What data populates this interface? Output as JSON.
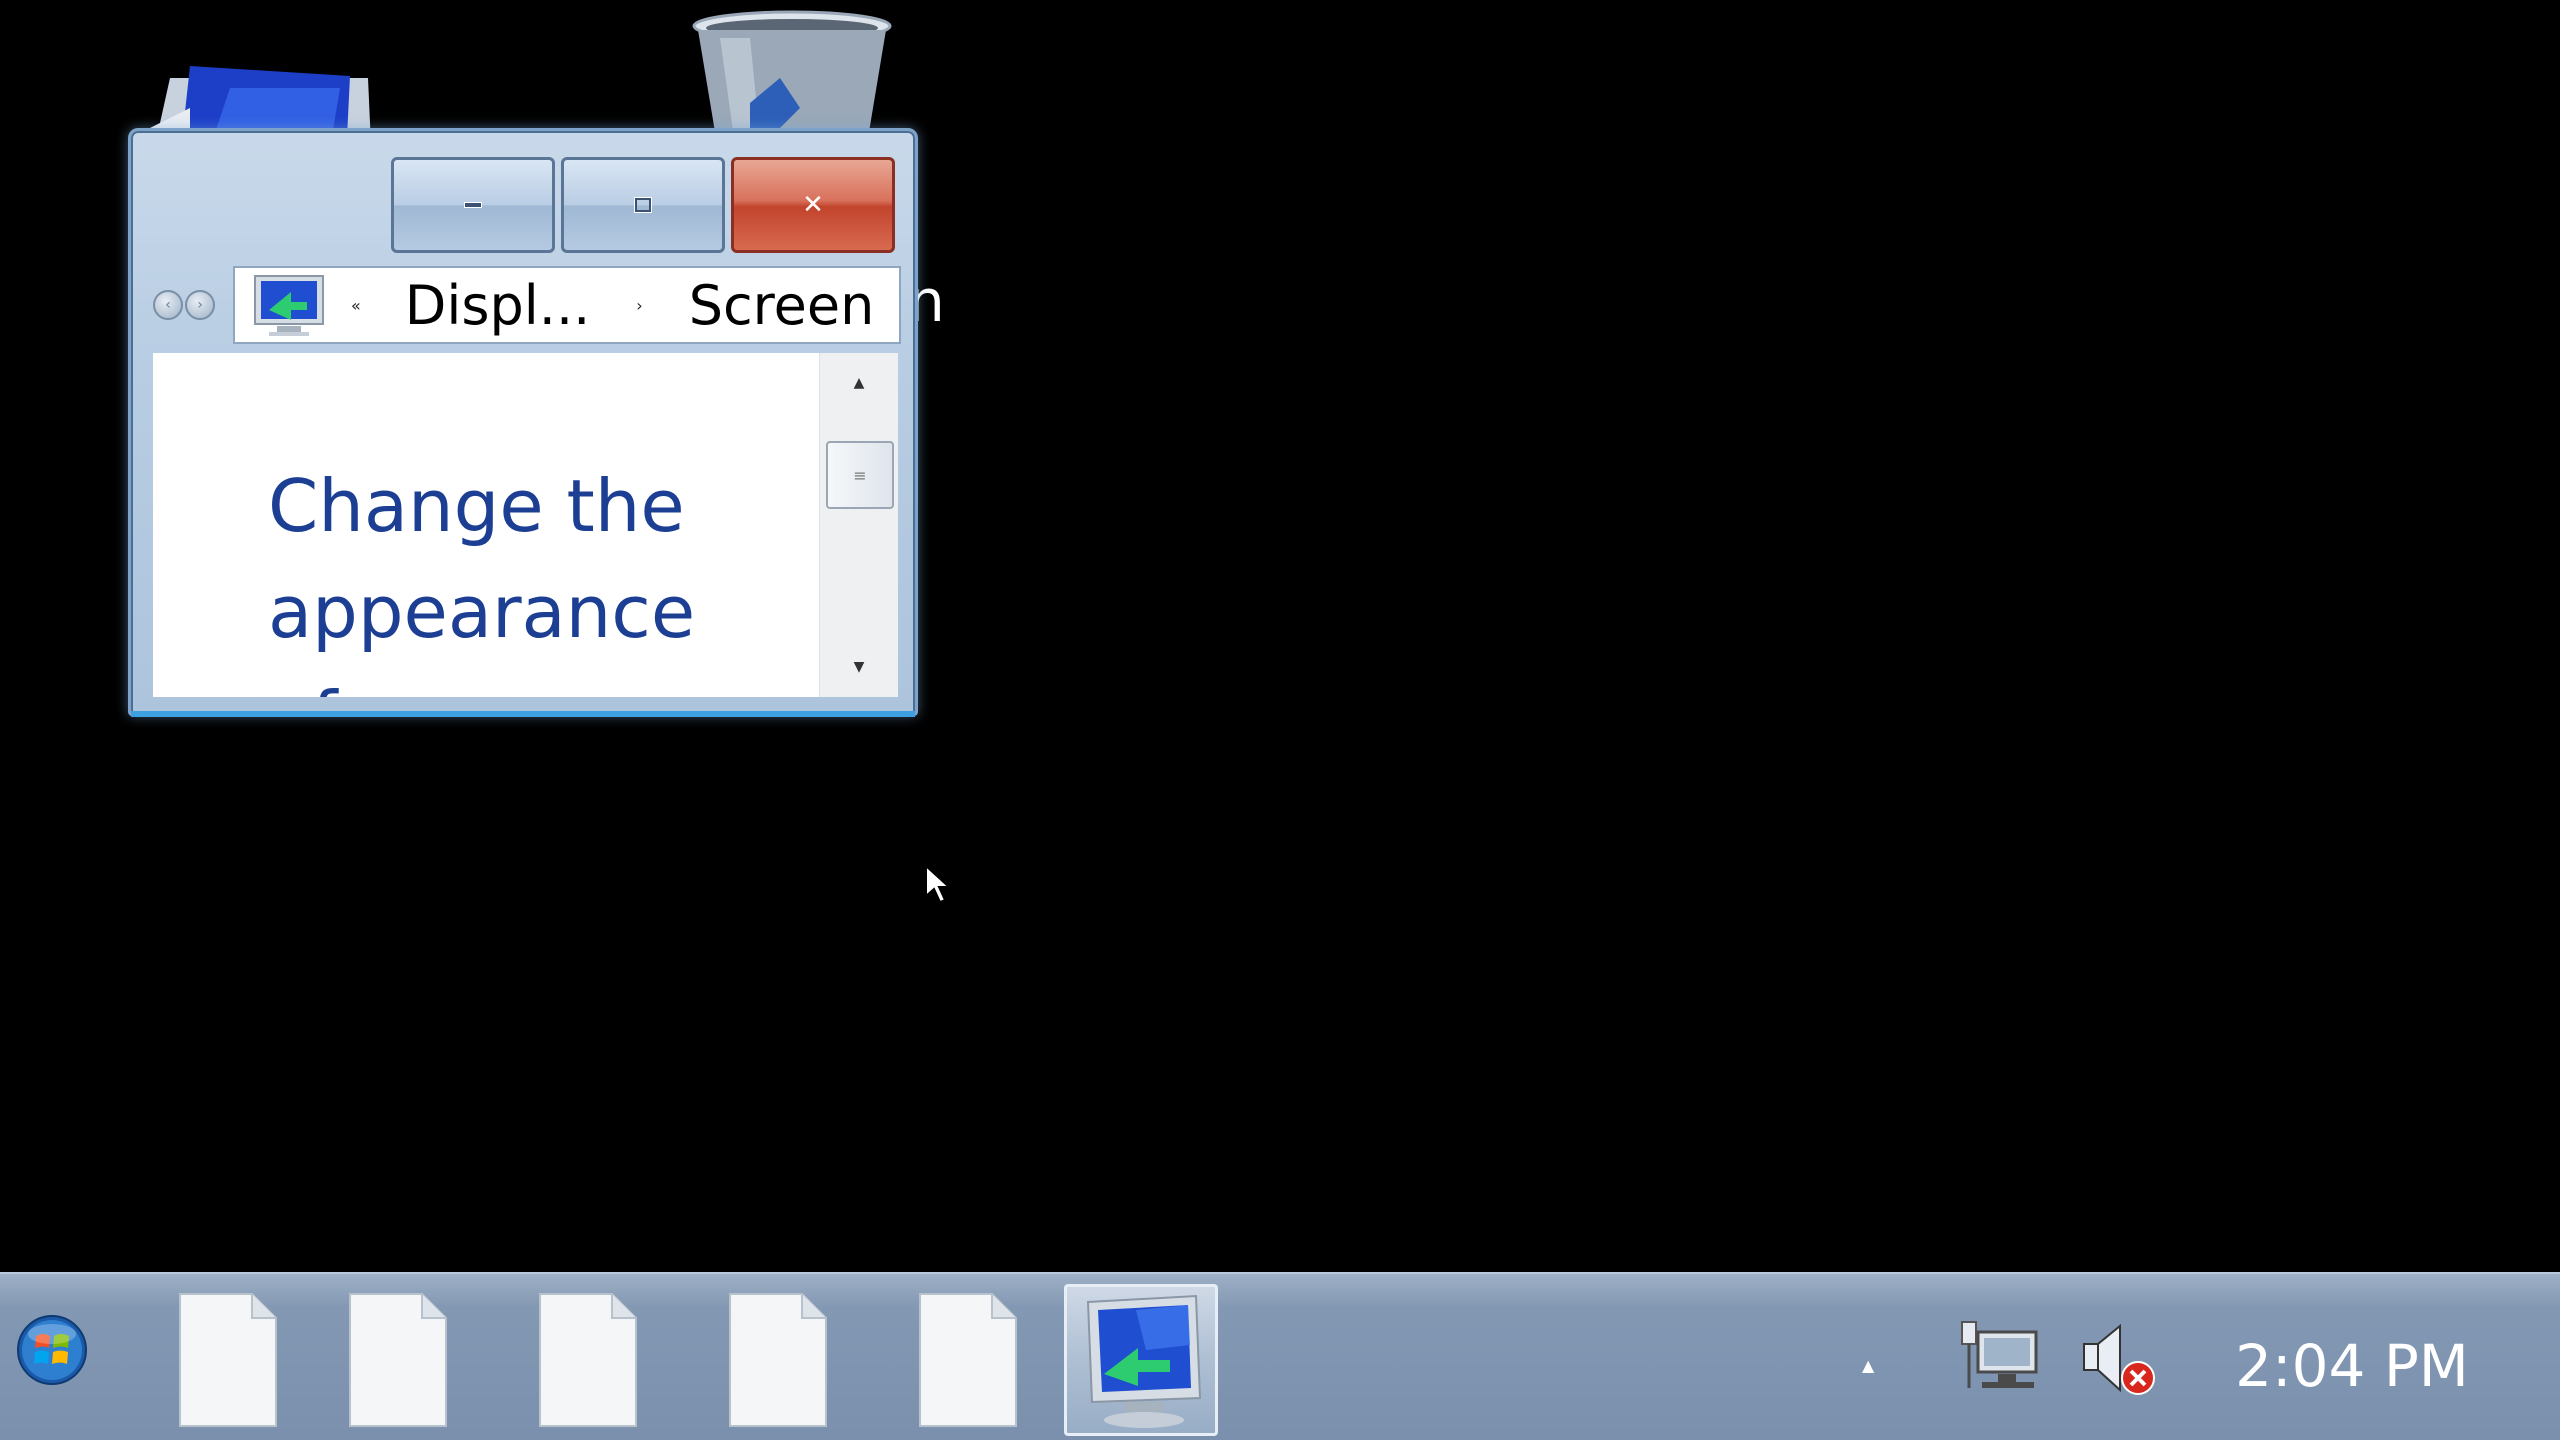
{
  "window": {
    "breadcrumb": {
      "segments": [
        "Displ...",
        "Screen"
      ],
      "leading_chevron": "«",
      "separator": "›"
    },
    "content": {
      "link_text": "Change the appearance of..."
    },
    "caption_buttons": {
      "close_label": "✕"
    }
  },
  "desktop": {
    "stray_text": "n"
  },
  "taskbar": {
    "pinned_items": [
      {
        "icon": "document-icon"
      },
      {
        "icon": "document-icon"
      },
      {
        "icon": "document-icon"
      },
      {
        "icon": "document-icon"
      },
      {
        "icon": "document-icon"
      },
      {
        "icon": "display-settings-icon",
        "active": true
      }
    ],
    "tray_overflow": "▲",
    "clock": "2:04 PM"
  },
  "colors": {
    "link": "#1c3f94",
    "close_button": "#c2442d",
    "taskbar": "#7a90ad"
  }
}
